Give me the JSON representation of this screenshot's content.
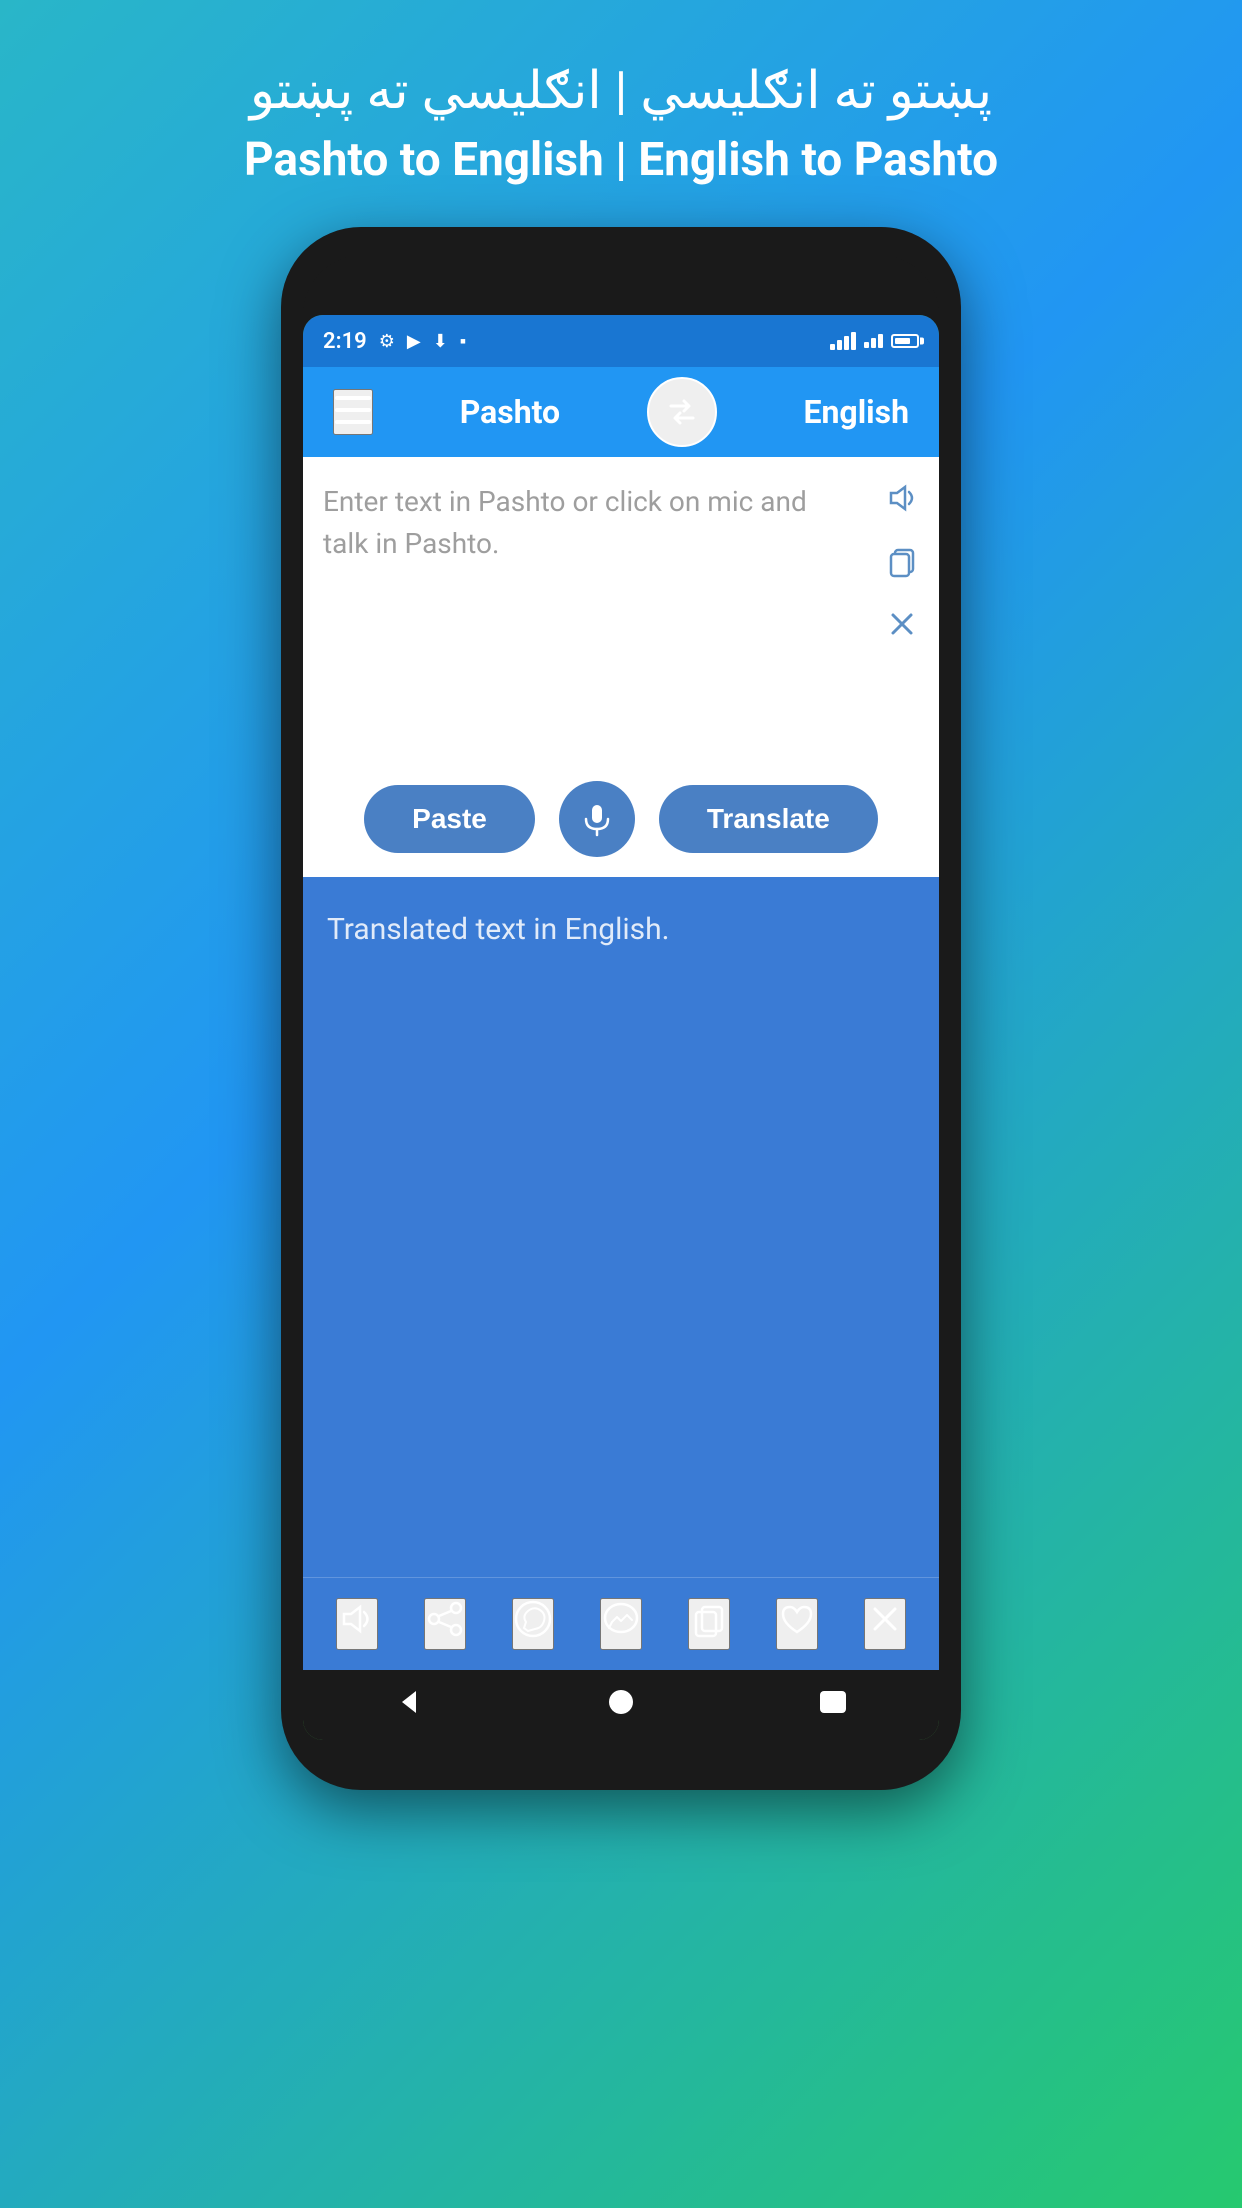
{
  "background": {
    "gradient_start": "#29b6c8",
    "gradient_end": "#26c96f"
  },
  "app_title": {
    "pashto_line": "پښتو ته انګليسي | انګليسي ته پښتو",
    "english_line": "Pashto to English | English to Pashto"
  },
  "status_bar": {
    "time": "2:19",
    "accent_color": "#1976d2"
  },
  "app_bar": {
    "from_lang": "Pashto",
    "to_lang": "English",
    "bg_color": "#2196f3"
  },
  "input_area": {
    "placeholder": "Enter text in Pashto or click on mic and talk in Pashto.",
    "paste_label": "Paste",
    "translate_label": "Translate"
  },
  "output_area": {
    "placeholder": "Translated text in English.",
    "bg_color": "#3a7bd5"
  },
  "bottom_bar": {
    "icons": [
      "volume",
      "share",
      "whatsapp",
      "messenger",
      "copy",
      "heart",
      "close"
    ]
  },
  "nav_bar": {
    "back": "◀",
    "home": "●",
    "recent": "■"
  }
}
